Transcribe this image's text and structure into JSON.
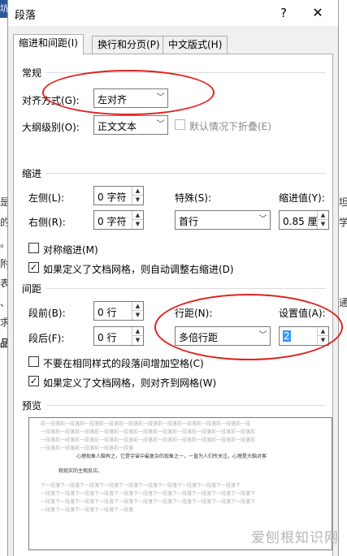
{
  "dialog": {
    "title": "段落",
    "help_label": "?",
    "close_label": "✕"
  },
  "tabs": [
    {
      "label": "缩进和间距(I)",
      "active": true
    },
    {
      "label": "换行和分页(P)",
      "active": false
    },
    {
      "label": "中文版式(H)",
      "active": false
    }
  ],
  "general": {
    "section": "常规",
    "alignment_label": "对齐方式(G):",
    "alignment_value": "左对齐",
    "outline_label": "大纲级别(O):",
    "outline_value": "正文文本",
    "collapse_label": "默认情况下折叠(E)"
  },
  "indent": {
    "section": "缩进",
    "left_label": "左侧(L):",
    "left_value": "0 字符",
    "right_label": "右侧(R):",
    "right_value": "0 字符",
    "special_label": "特殊(S):",
    "special_value": "首行",
    "indent_by_label": "缩进值(Y):",
    "indent_by_value": "0.85 厘米",
    "mirror_label": "对称缩进(M)",
    "auto_adjust_label": "如果定义了文档网格，则自动调整右缩进(D)"
  },
  "spacing": {
    "section": "间距",
    "before_label": "段前(B):",
    "before_value": "0 行",
    "after_label": "段后(F):",
    "after_value": "0 行",
    "line_spacing_label": "行距(N):",
    "line_spacing_value": "多倍行距",
    "at_label": "设置值(A):",
    "at_value": "2",
    "no_space_label": "不要在相同样式的段落间增加空格(C)",
    "snap_grid_label": "如果定义了文档网格，则对齐到网格(W)"
  },
  "preview": {
    "section": "预览",
    "prev_lines": [
      "前一段落前一段落前一段落前一段落前一段落前一段落前一段落前一段落前一段落前一段落前一段",
      "一段落前一段落前一段落前一段落前一段落前一段落前一段落前一段落前一段落前一段落前一段落前",
      "一段落前一段落前一段落前一段落前一段落前一段落前一段落前一段落前一段落前一段落前一段落前",
      "一段落前一段落前一段落前一段落前一段落"
    ],
    "sample_line_1": "心理现象人脑有之，它是宇宙中最复杂的现象之一，一直为人们所关注。心理是大脑对客",
    "sample_line_2": "观现实的主观反应。",
    "next_lines": [
      "下一段落下一段落下一段落下一段落下一段落下一段落下一段落下一段落下一段落下一段落下",
      "一段落下一段落下一段落下一段落下一段落下一段落下一段落下一段落下一段落下一段落下一段落下",
      "一段落下一段落下一段落下一段落下一段落下一段落下一段落下一段落下一段落下一段落下一段落下",
      "一段落下一段落下一段落下一段落下一段落"
    ]
  },
  "background_doc": {
    "strip_label": "坑",
    "left_chars": [
      "是",
      "的",
      "。",
      "附",
      "表",
      "、",
      "求",
      "品"
    ],
    "right_chars": [
      "坦",
      "学",
      "",
      "",
      "",
      "通",
      "",
      ""
    ]
  },
  "watermark": "爱刨根知识网",
  "annotation_color": "#e0201e"
}
